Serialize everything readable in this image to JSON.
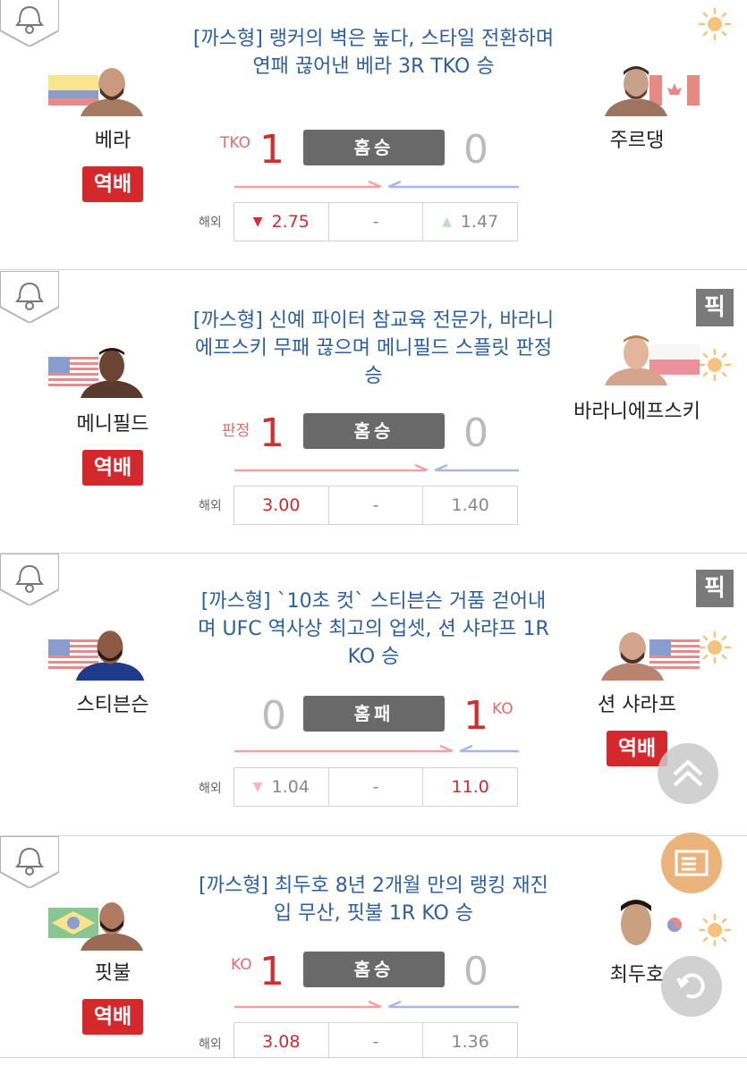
{
  "matches": [
    {
      "headline": "[까스형] 랭커의 벽은 높다, 스타일 전환하며 연패 끊어낸 베라 3R TKO 승",
      "home": {
        "name": "베라",
        "badge": "역배",
        "flag": "ecuador"
      },
      "away": {
        "name": "주르댕",
        "badge": "",
        "flag": "canada"
      },
      "result_label": "홈승",
      "home_score": "1",
      "away_score": "0",
      "method": "TKO",
      "odds_label": "해외",
      "odds": {
        "home": "2.75",
        "draw": "-",
        "away": "1.47"
      },
      "pick": ""
    },
    {
      "headline": "[까스형] 신예 파이터 참교육 전문가, 바라니에프스키 무패 끊으며 메니필드 스플릿 판정 승",
      "home": {
        "name": "메니필드",
        "badge": "역배",
        "flag": "usa"
      },
      "away": {
        "name": "바라니에프스키",
        "badge": "",
        "flag": "poland"
      },
      "result_label": "홈승",
      "home_score": "1",
      "away_score": "0",
      "method": "판정",
      "odds_label": "해외",
      "odds": {
        "home": "3.00",
        "draw": "-",
        "away": "1.40"
      },
      "pick": "픽"
    },
    {
      "headline": "[까스형] `10초 컷` 스티븐슨 거품 걷어내며 UFC 역사상 최고의 업셋, 션 샤랴프 1R KO 승",
      "home": {
        "name": "스티븐슨",
        "badge": "",
        "flag": "usa"
      },
      "away": {
        "name": "션 샤라프",
        "badge": "역배",
        "flag": "usa"
      },
      "result_label": "홈패",
      "home_score": "0",
      "away_score": "1",
      "method": "KO",
      "odds_label": "해외",
      "odds": {
        "home": "1.04",
        "draw": "-",
        "away": "11.0"
      },
      "pick": "픽"
    },
    {
      "headline": "[까스형] 최두호 8년 2개월 만의 랭킹 재진입 무산, 핏불 1R KO 승",
      "home": {
        "name": "핏불",
        "badge": "역배",
        "flag": "brazil"
      },
      "away": {
        "name": "최두호",
        "badge": "",
        "flag": "korea"
      },
      "result_label": "홈승",
      "home_score": "1",
      "away_score": "0",
      "method": "KO",
      "odds_label": "해외",
      "odds": {
        "home": "3.08",
        "draw": "-",
        "away": "1.36"
      },
      "pick": ""
    }
  ],
  "colors": {
    "headline": "#2c5f9e",
    "win": "#cf2f2f",
    "badge": "#d5282c",
    "result_bg": "#696969"
  }
}
